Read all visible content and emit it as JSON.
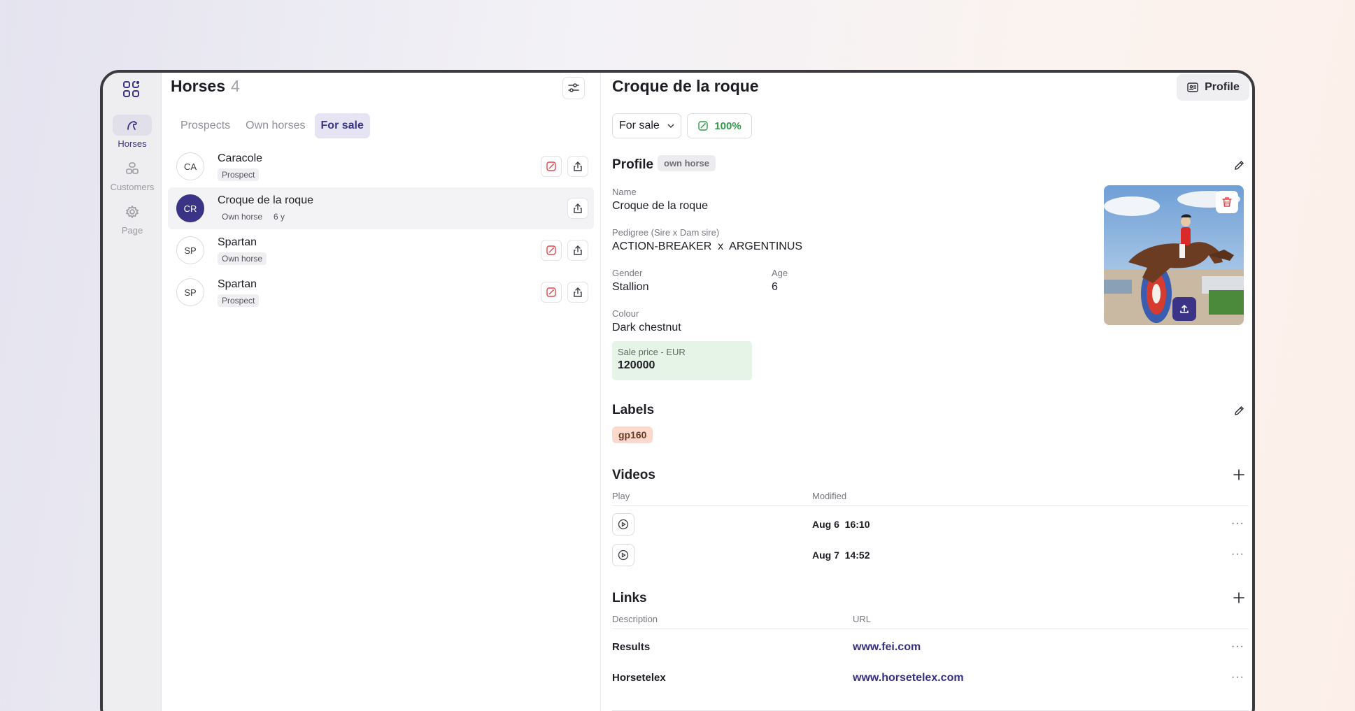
{
  "rail": {
    "items": [
      {
        "label": "Horses",
        "icon": "horse-icon",
        "active": true
      },
      {
        "label": "Customers",
        "icon": "customers-icon",
        "active": false
      },
      {
        "label": "Page",
        "icon": "gear-icon",
        "active": false
      }
    ]
  },
  "list": {
    "title": "Horses",
    "count": "4",
    "tabs": [
      {
        "label": "Prospects",
        "active": false
      },
      {
        "label": "Own horses",
        "active": false
      },
      {
        "label": "For sale",
        "active": true
      }
    ],
    "rows": [
      {
        "initials": "CA",
        "name": "Caracole",
        "chip": "Prospect",
        "extra": "",
        "selected": false,
        "has_sale_icon": true
      },
      {
        "initials": "CR",
        "name": "Croque de la roque",
        "chip": "Own horse",
        "extra": "6 y",
        "selected": true,
        "has_sale_icon": false
      },
      {
        "initials": "SP",
        "name": "Spartan",
        "chip": "Own horse",
        "extra": "",
        "selected": false,
        "has_sale_icon": true
      },
      {
        "initials": "SP",
        "name": "Spartan",
        "chip": "Prospect",
        "extra": "",
        "selected": false,
        "has_sale_icon": true
      }
    ]
  },
  "detail": {
    "title": "Croque de la roque",
    "profile_button": "Profile",
    "status": "For sale",
    "completeness": "100%",
    "profile": {
      "heading": "Profile",
      "chip": "own horse",
      "name_label": "Name",
      "name_value": "Croque de la roque",
      "pedigree_label": "Pedigree (Sire x Dam sire)",
      "pedigree_value": "ACTION-BREAKER  x  ARGENTINUS",
      "gender_label": "Gender",
      "gender_value": "Stallion",
      "age_label": "Age",
      "age_value": "6",
      "colour_label": "Colour",
      "colour_value": "Dark chestnut",
      "price_label": "Sale price - EUR",
      "price_value": "120000"
    },
    "labels": {
      "heading": "Labels",
      "items": [
        "gp160"
      ]
    },
    "videos": {
      "heading": "Videos",
      "col_play": "Play",
      "col_modified": "Modified",
      "rows": [
        {
          "modified": "Aug 6  16:10"
        },
        {
          "modified": "Aug 7  14:52"
        }
      ]
    },
    "links": {
      "heading": "Links",
      "col_description": "Description",
      "col_url": "URL",
      "rows": [
        {
          "description": "Results",
          "url": "www.fei.com"
        },
        {
          "description": "Horsetelex",
          "url": "www.horsetelex.com"
        }
      ]
    }
  },
  "colors": {
    "accent": "#3b3486",
    "sale_green": "#2f9b48",
    "price_bg": "#e5f4e7",
    "label_bg": "#fbd9cc",
    "danger": "#e0474c"
  }
}
